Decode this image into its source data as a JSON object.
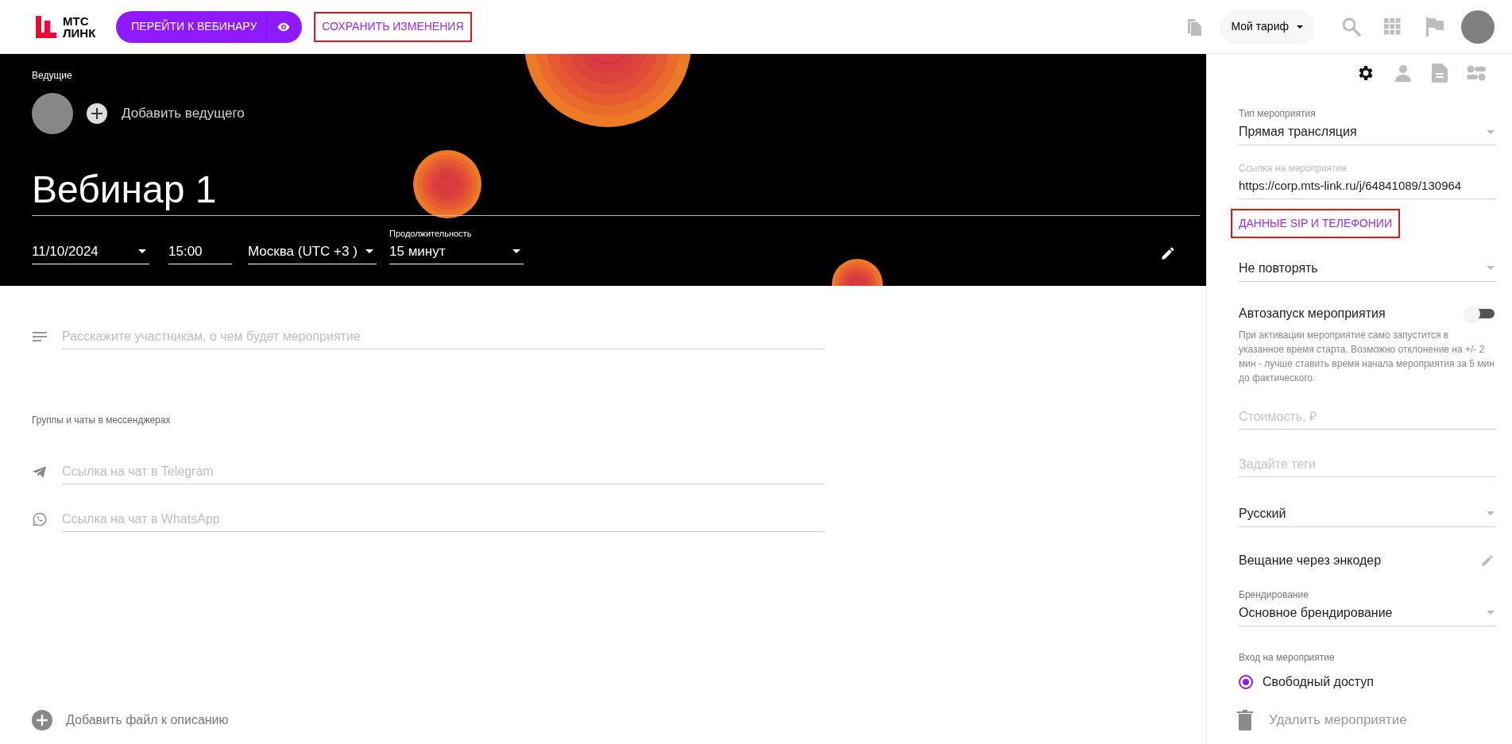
{
  "header": {
    "logo": {
      "line_1": "МТС",
      "line_2": "ЛИНК"
    },
    "go_button": "ПЕРЕЙТИ К ВЕБИНАРУ",
    "save_button": "СОХРАНИТЬ ИЗМЕНЕНИЯ",
    "plan_button": "Мой тариф"
  },
  "banner": {
    "hosts_label": "Ведущие",
    "add_host": "Добавить ведущего",
    "title": "Вебинар 1",
    "date": "11/10/2024",
    "time": "15:00",
    "timezone": "Москва (UTC +3 )",
    "duration_label": "Продолжительность",
    "duration": "15 минут"
  },
  "description": {
    "placeholder": "Расскажите участникам, о чем будет мероприятие"
  },
  "messengers": {
    "label": "Группы и чаты в мессенджерах",
    "fields": [
      {
        "kind": "telegram",
        "placeholder": "Ссылка на чат в Telegram"
      },
      {
        "kind": "whatsapp",
        "placeholder": "Ссылка на чат в WhatsApp"
      }
    ]
  },
  "add_file": "Добавить файл к описанию",
  "side_panel": {
    "tabs": [
      {
        "kind": "settings",
        "selected": true
      },
      {
        "kind": "person",
        "selected": false
      },
      {
        "kind": "document",
        "selected": false
      },
      {
        "kind": "toggles",
        "selected": false
      }
    ],
    "event_type": {
      "label": "Тип мероприятия",
      "value": "Прямая трансляция"
    },
    "event_link": {
      "label": "Ссылка на мероприятие",
      "value": "https://corp.mts-link.ru/j/64841089/130964"
    },
    "sip_link": "ДАННЫЕ SIP И ТЕЛЕФОНИИ",
    "repeat": "Не повторять",
    "autostart": {
      "label": "Автозапуск мероприятия",
      "on": false,
      "hint": "При активации мероприятие само запустится в указанное время старта. Возможно отклонение на +/- 2 мин - лучше ставить время начала мероприятия за 5 мин до фактического."
    },
    "price": {
      "placeholder": "Стоимость, ₽"
    },
    "tags": {
      "placeholder": "Задайте теги"
    },
    "language": "Русский",
    "encoder": "Вещание через энкодер",
    "branding": {
      "label": "Брендирование",
      "value": "Основное брендирование"
    },
    "access": {
      "label": "Вход на мероприятие",
      "options": [
        {
          "label": "Свободный доступ",
          "selected": true
        }
      ]
    },
    "delete_button": "Удалить мероприятие"
  }
}
